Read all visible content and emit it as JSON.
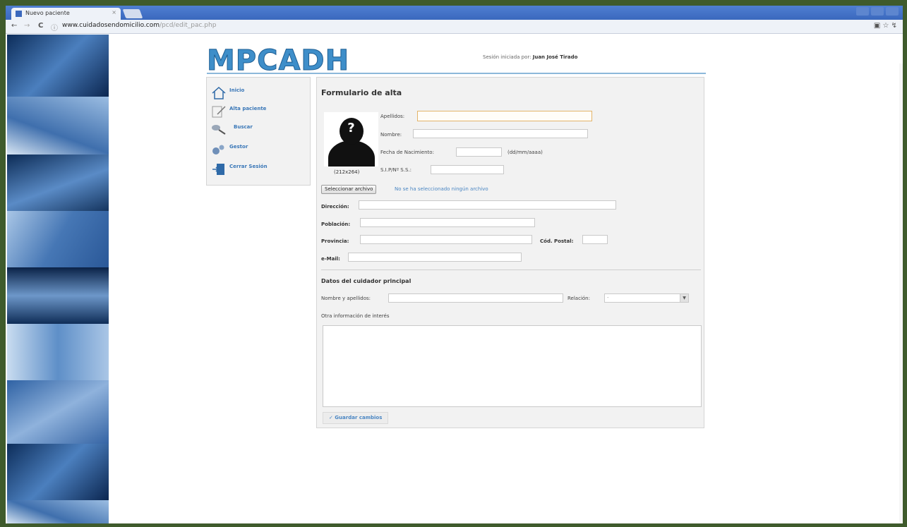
{
  "browser": {
    "tab_title": "Nuevo paciente",
    "tab_close": "×",
    "url_host": "www.cuidadosendomicilio.com",
    "url_path": "/pcd/edit_pac.php"
  },
  "header": {
    "logo": "MPCADH",
    "session_label": "Sesión iniciada por:",
    "session_user": "Juan José Tirado"
  },
  "sidebar": {
    "items": [
      {
        "label": "Inicio"
      },
      {
        "label": "Alta paciente"
      },
      {
        "label": "Buscar"
      },
      {
        "label": "Gestor"
      },
      {
        "label": "Cerrar Sesión"
      }
    ]
  },
  "form": {
    "title": "Formulario de alta",
    "photo_size": "(212x264)",
    "fields": {
      "apellidos": "Apellidos:",
      "nombre": "Nombre:",
      "fecha": "Fecha de Nacimiento:",
      "fecha_hint": "(dd/mm/aaaa)",
      "sip": "S.I.P/Nº S.S.:",
      "direccion": "Dirección:",
      "poblacion": "Población:",
      "provincia": "Provincia:",
      "cod_postal": "Cód. Postal:",
      "email": "e-Mail:"
    },
    "file_button": "Seleccionar archivo",
    "file_status": "No se ha seleccionado ningún archivo",
    "caregiver_title": "Datos del cuidador principal",
    "caregiver_name": "Nombre y apellidos:",
    "relacion": "Relación:",
    "relacion_value": "-",
    "other_info": "Otra información de interés",
    "save_button": "✓ Guardar cambios"
  }
}
